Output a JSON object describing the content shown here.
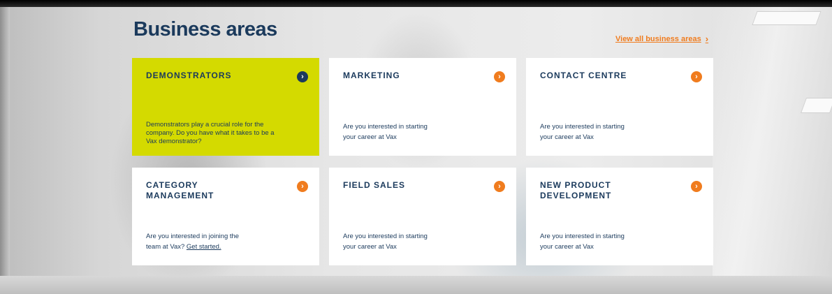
{
  "section": {
    "title": "Business areas",
    "view_all_label": "View all business areas",
    "view_all_icon": "chevron-right-icon"
  },
  "colors": {
    "navy": "#1b3a5c",
    "accent_orange": "#f07c1e",
    "highlight_lime": "#d4da00",
    "card_bg": "#ffffff"
  },
  "cards": [
    {
      "title": "DEMONSTRATORS",
      "description": "Demonstrators play a crucial role for the company. Do you have what it takes to be a Vax demonstrator?",
      "active": true,
      "icon": "arrow-right-circle-icon"
    },
    {
      "title": "MARKETING",
      "description_line1": "Are you interested in starting",
      "description_line2": "your career at Vax",
      "icon": "arrow-right-circle-icon"
    },
    {
      "title": "CONTACT CENTRE",
      "description_line1": "Are you interested in starting",
      "description_line2": "your career at Vax",
      "icon": "arrow-right-circle-icon"
    },
    {
      "title": "CATEGORY MANAGEMENT",
      "description_line1": "Are you interested in joining the",
      "description_line2_prefix": "team at Vax? ",
      "description_link": "Get started.",
      "icon": "arrow-right-circle-icon"
    },
    {
      "title": "FIELD SALES",
      "description_line1": "Are you interested in starting",
      "description_line2": "your career at Vax",
      "icon": "arrow-right-circle-icon"
    },
    {
      "title": "NEW PRODUCT DEVELOPMENT",
      "description_line1": "Are you interested in starting",
      "description_line2": "your career at Vax",
      "icon": "arrow-right-circle-icon"
    }
  ]
}
